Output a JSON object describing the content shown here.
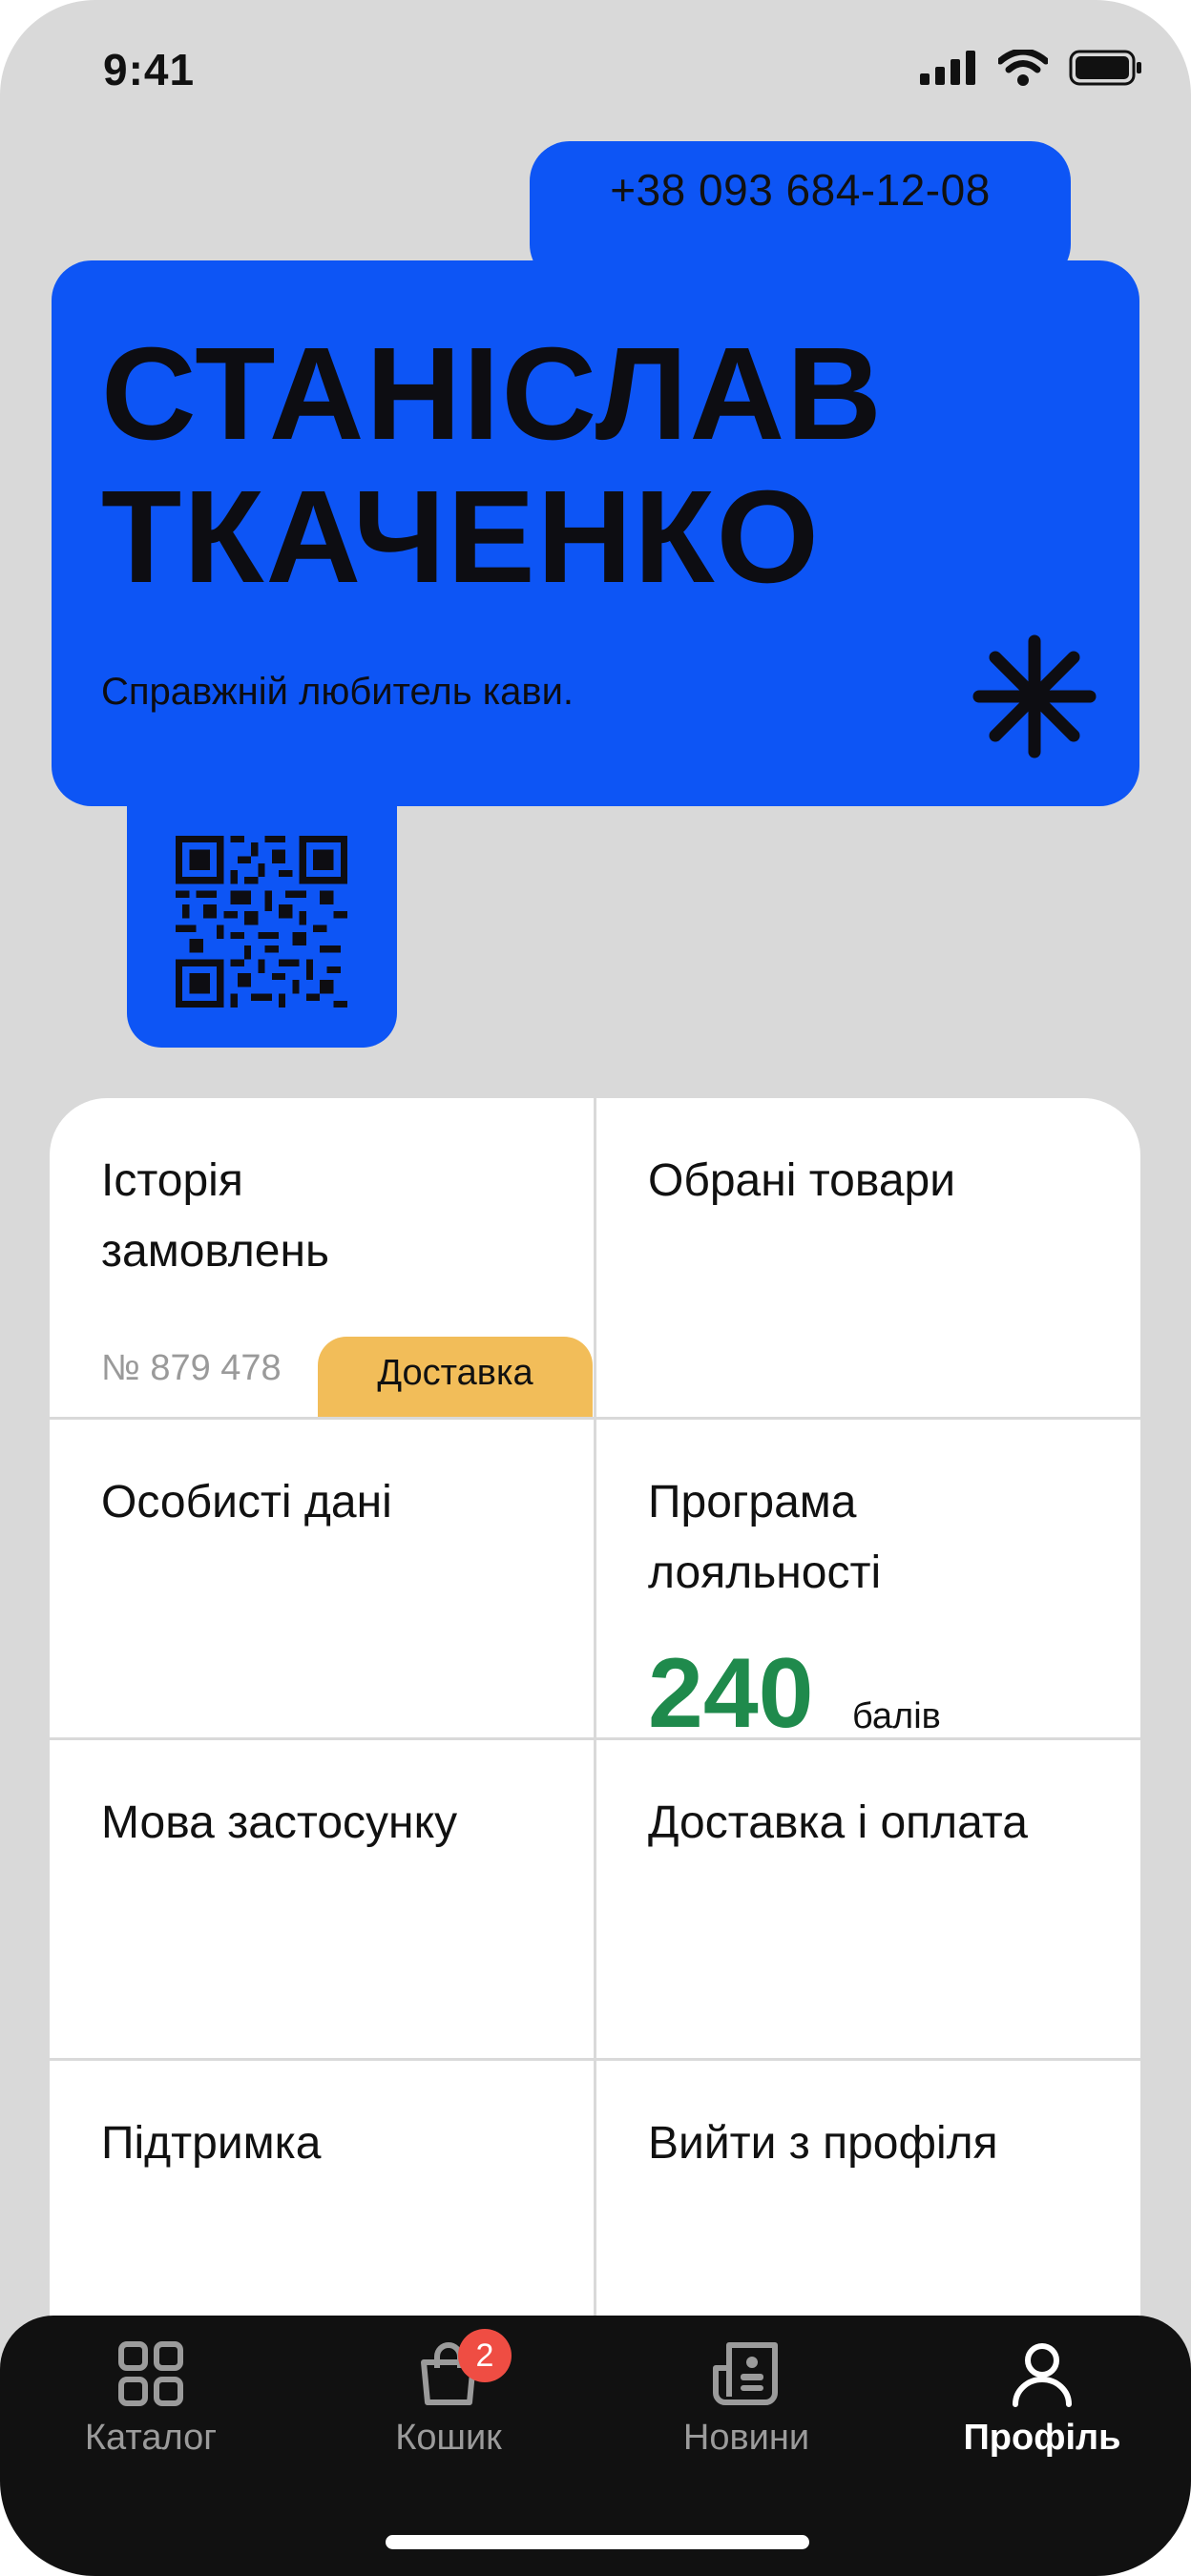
{
  "status_bar": {
    "time": "9:41"
  },
  "profile": {
    "phone": "+38 093 684-12-08",
    "first_name": "СТАНІСЛАВ",
    "last_name": "ТКАЧЕНКО",
    "tagline": "Справжній любитель кави."
  },
  "menu": {
    "order_history": {
      "title": "Історія замовлень",
      "order_number": "№ 879 478",
      "status": "Доставка"
    },
    "favorites": {
      "title": "Обрані товари"
    },
    "personal_data": {
      "title": "Особисті дані"
    },
    "loyalty": {
      "title": "Програма лояльності",
      "points": "240",
      "points_unit": "балів"
    },
    "language": {
      "title": "Мова застосунку"
    },
    "delivery_payment": {
      "title": "Доставка і оплата"
    },
    "support": {
      "title": "Підтримка"
    },
    "logout": {
      "title": "Вийти з профіля"
    }
  },
  "tabbar": {
    "items": [
      {
        "label": "Каталог",
        "icon": "grid-icon",
        "active": false
      },
      {
        "label": "Кошик",
        "icon": "shopping-bag-icon",
        "active": false,
        "badge": "2"
      },
      {
        "label": "Новини",
        "icon": "news-icon",
        "active": false
      },
      {
        "label": "Профіль",
        "icon": "user-icon",
        "active": true
      }
    ]
  },
  "colors": {
    "accent_blue": "#0d55f5",
    "points_green": "#1f8a4c",
    "status_badge": "#f2bd59",
    "cart_badge": "#ef4d43"
  }
}
